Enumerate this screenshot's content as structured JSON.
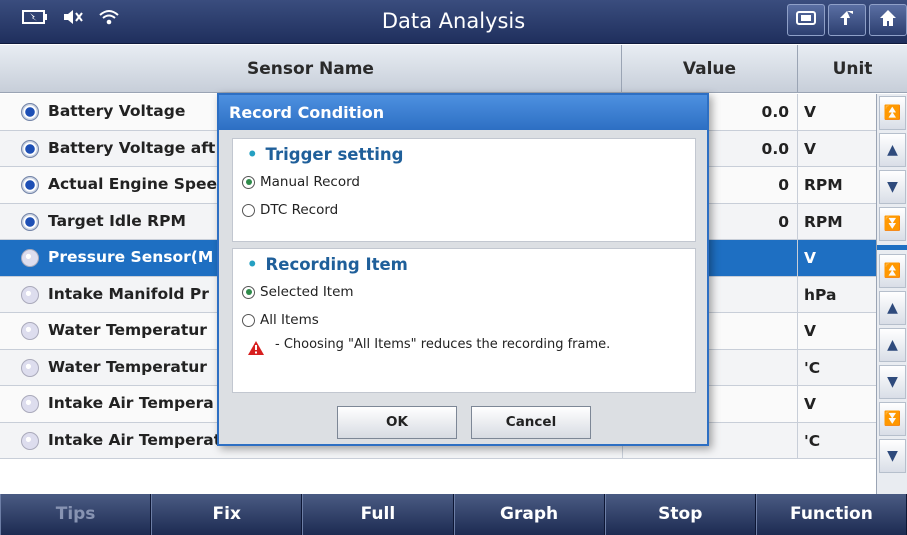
{
  "titlebar": {
    "title": "Data Analysis",
    "status_icons": [
      "battery-icon",
      "speaker-muted-icon",
      "wifi-icon"
    ],
    "buttons": [
      "screenshot-icon",
      "back-icon",
      "home-icon"
    ]
  },
  "table": {
    "headers": {
      "name": "Sensor Name",
      "value": "Value",
      "unit": "Unit"
    },
    "rows": [
      {
        "name": "Battery Voltage",
        "value": "0.0",
        "unit": "V",
        "checked": true
      },
      {
        "name": "Battery Voltage aft",
        "value": "0.0",
        "unit": "V",
        "checked": true
      },
      {
        "name": "Actual Engine Spee",
        "value": "0",
        "unit": "RPM",
        "checked": true
      },
      {
        "name": "Target Idle RPM",
        "value": "0",
        "unit": "RPM",
        "checked": true
      },
      {
        "name": "Pressure Sensor(M",
        "value": "",
        "unit": "V",
        "checked": false,
        "selected": true
      },
      {
        "name": "Intake Manifold Pr",
        "value": "",
        "unit": "hPa",
        "checked": false
      },
      {
        "name": "Water Temperatur",
        "value": "",
        "unit": "V",
        "checked": false
      },
      {
        "name": "Water Temperatur",
        "value": "",
        "unit": "'C",
        "checked": false
      },
      {
        "name": "Intake Air Tempera",
        "value": "",
        "unit": "V",
        "checked": false
      },
      {
        "name": "Intake Air Temperature",
        "value": "",
        "unit": "'C",
        "checked": false
      }
    ]
  },
  "dialog": {
    "title": "Record Condition",
    "trigger": {
      "heading": "Trigger setting",
      "options": [
        {
          "label": "Manual Record",
          "selected": true
        },
        {
          "label": "DTC Record",
          "selected": false
        }
      ]
    },
    "recording": {
      "heading": "Recording Item",
      "options": [
        {
          "label": "Selected Item",
          "selected": true
        },
        {
          "label": "All Items",
          "selected": false
        }
      ],
      "warning": "- Choosing \"All Items\" reduces the recording frame."
    },
    "ok_label": "OK",
    "cancel_label": "Cancel"
  },
  "bottombar": {
    "buttons": [
      {
        "label": "Tips",
        "enabled": false
      },
      {
        "label": "Fix",
        "enabled": true
      },
      {
        "label": "Full",
        "enabled": true
      },
      {
        "label": "Graph",
        "enabled": true
      },
      {
        "label": "Stop",
        "enabled": true
      },
      {
        "label": "Function",
        "enabled": true
      }
    ]
  },
  "colors": {
    "accent": "#2d6fc3",
    "selected_row": "#1e6fc2",
    "heading": "#1f5f9a"
  }
}
